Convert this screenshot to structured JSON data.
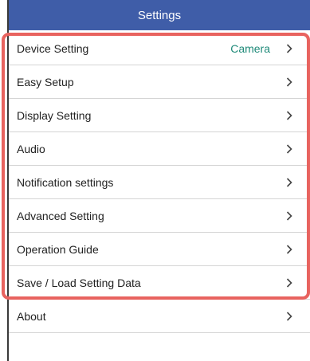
{
  "header": {
    "title": "Settings"
  },
  "items": [
    {
      "label": "Device Setting",
      "value": "Camera"
    },
    {
      "label": "Easy Setup",
      "value": ""
    },
    {
      "label": "Display Setting",
      "value": ""
    },
    {
      "label": "Audio",
      "value": ""
    },
    {
      "label": "Notification settings",
      "value": ""
    },
    {
      "label": "Advanced Setting",
      "value": ""
    },
    {
      "label": "Operation Guide",
      "value": ""
    },
    {
      "label": "Save / Load Setting Data",
      "value": ""
    },
    {
      "label": "About",
      "value": ""
    }
  ],
  "colors": {
    "header_bg": "#3f5da8",
    "value_text": "#1f8a79",
    "highlight_border": "#e8635f"
  },
  "icons": {
    "row_chevron": "chevron-right-icon"
  }
}
